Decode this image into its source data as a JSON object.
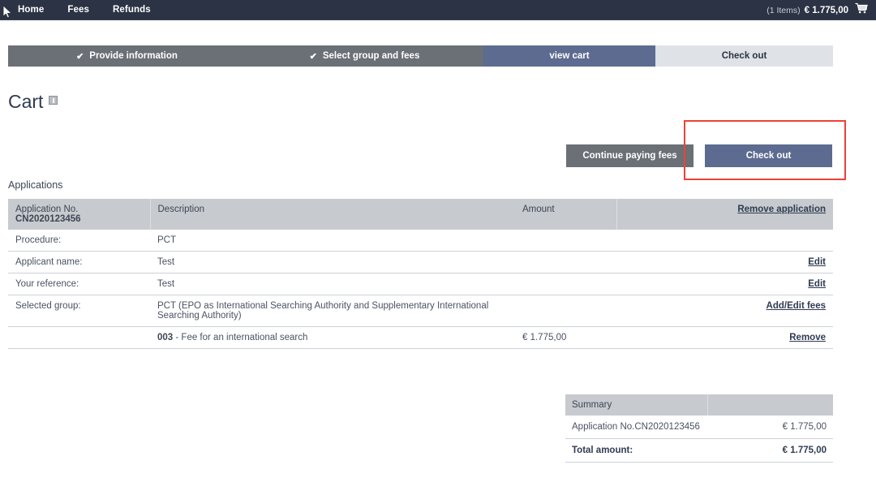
{
  "nav": {
    "items": [
      {
        "label": "Home",
        "name": "nav-item-home"
      },
      {
        "label": "Fees",
        "name": "nav-item-fees"
      },
      {
        "label": "Refunds",
        "name": "nav-item-refunds"
      }
    ],
    "cart": {
      "count_label": "(1 Items)",
      "total": "€ 1.775,00",
      "icon": "shopping-cart-icon"
    }
  },
  "stepper": {
    "steps": [
      {
        "label": "Provide information",
        "state": "done",
        "check": "✔"
      },
      {
        "label": "Select group and fees",
        "state": "done",
        "check": "✔"
      },
      {
        "label": "view cart",
        "state": "active",
        "check": ""
      },
      {
        "label": "Check out",
        "state": "next",
        "check": ""
      }
    ]
  },
  "page": {
    "title": "Cart",
    "help_icon": "help-info-icon"
  },
  "actions": {
    "continue_label": "Continue paying fees",
    "checkout_label": "Check out",
    "highlight_color": "#ef4136"
  },
  "applications": {
    "section_label": "Applications",
    "header": {
      "application_no_label": "Application No.",
      "application_no_value": "CN2020123456",
      "description": "Description",
      "amount": "Amount",
      "remove_application": "Remove application"
    },
    "rows": [
      {
        "label": "Procedure:",
        "value": "PCT",
        "amount": "",
        "action": ""
      },
      {
        "label": "Applicant name:",
        "value": "Test",
        "amount": "",
        "action": "Edit"
      },
      {
        "label": "Your reference:",
        "value": "Test",
        "amount": "",
        "action": "Edit"
      },
      {
        "label": "Selected group:",
        "value": "PCT (EPO as International Searching Authority and Supplementary International Searching Authority)",
        "amount": "",
        "action": "Add/Edit fees"
      }
    ],
    "fee_row": {
      "code": "003",
      "description": "- Fee for an international search",
      "amount": "€ 1.775,00",
      "action": "Remove"
    }
  },
  "summary": {
    "title": "Summary",
    "line_label": "Application No.CN2020123456",
    "line_value": "€ 1.775,00",
    "total_label": "Total amount:",
    "total_value": "€ 1.775,00"
  }
}
